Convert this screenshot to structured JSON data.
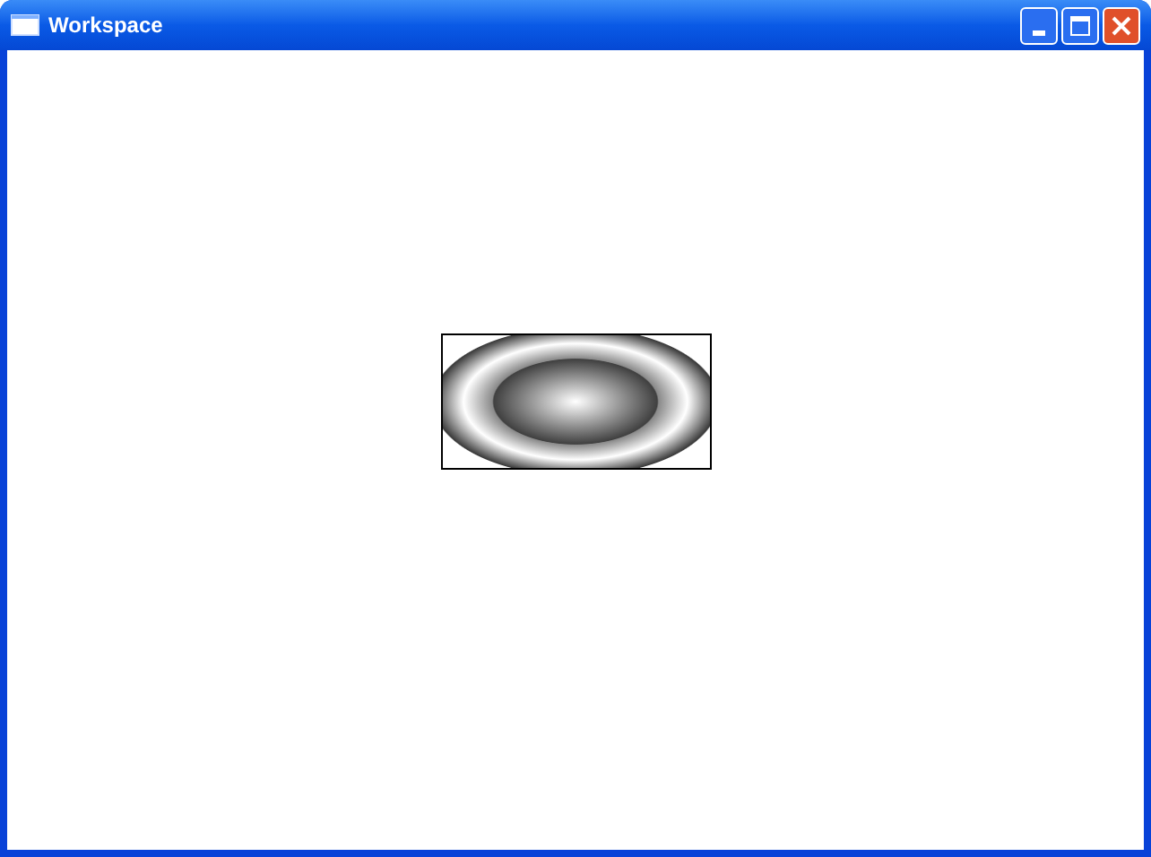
{
  "window": {
    "title": "Workspace"
  }
}
